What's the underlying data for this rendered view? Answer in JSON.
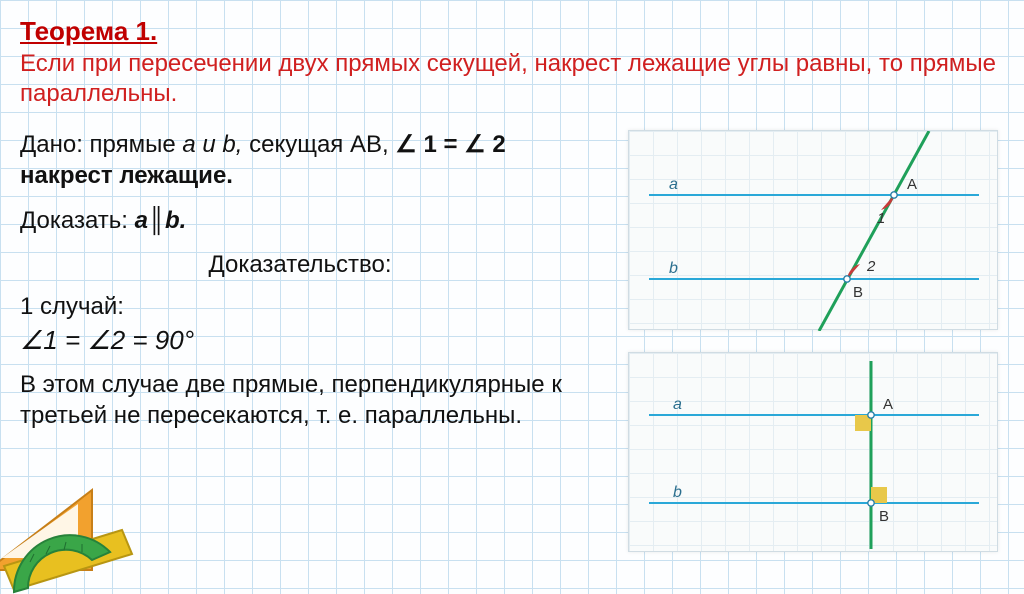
{
  "title": "Теорема 1.",
  "theorem_text": "Если при пересечении двух прямых секущей, накрест лежащие углы равны, то прямые параллельны.",
  "given": {
    "prefix": "Дано: прямые ",
    "ab": "a и b,",
    "secant": " секущая AB,",
    "angles": " ∠ 1 = ∠ 2 накрест лежащие."
  },
  "prove": {
    "label": "Доказать: ",
    "stmt": "a║b."
  },
  "proof_heading": "Доказательство:",
  "case1_label": "1 случай:",
  "case1_eq": "∠1 = ∠2 = 90°",
  "case1_text": "В этом случае две прямые, перпендикулярные к третьей не пересекаются, т. е. параллельны.",
  "fig1": {
    "a": "a",
    "b": "b",
    "A": "A",
    "B": "B",
    "n1": "1",
    "n2": "2"
  },
  "fig2": {
    "a": "a",
    "b": "b",
    "A": "A",
    "B": "B"
  }
}
